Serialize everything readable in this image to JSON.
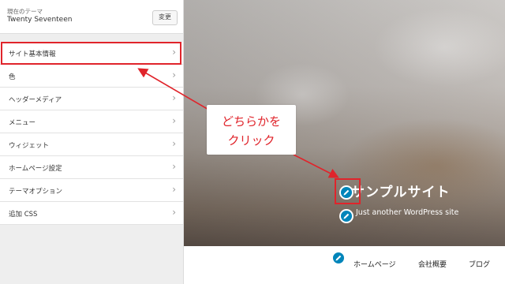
{
  "sidebar": {
    "theme_caption": "現在のテーマ",
    "theme_name": "Twenty Seventeen",
    "change_button": "変更",
    "items": [
      {
        "label": "サイト基本情報"
      },
      {
        "label": "色"
      },
      {
        "label": "ヘッダーメディア"
      },
      {
        "label": "メニュー"
      },
      {
        "label": "ウィジェット"
      },
      {
        "label": "ホームページ設定"
      },
      {
        "label": "テーマオプション"
      },
      {
        "label": "追加 CSS"
      }
    ]
  },
  "preview": {
    "site_title": "サンプルサイト",
    "tagline": "Just another WordPress site",
    "nav": [
      "ホームページ",
      "会社概要",
      "ブログ"
    ]
  },
  "annotation": {
    "line1": "どちらかを",
    "line2": "クリック",
    "color": "#e0242b"
  },
  "colors": {
    "accent": "#0085ba"
  }
}
